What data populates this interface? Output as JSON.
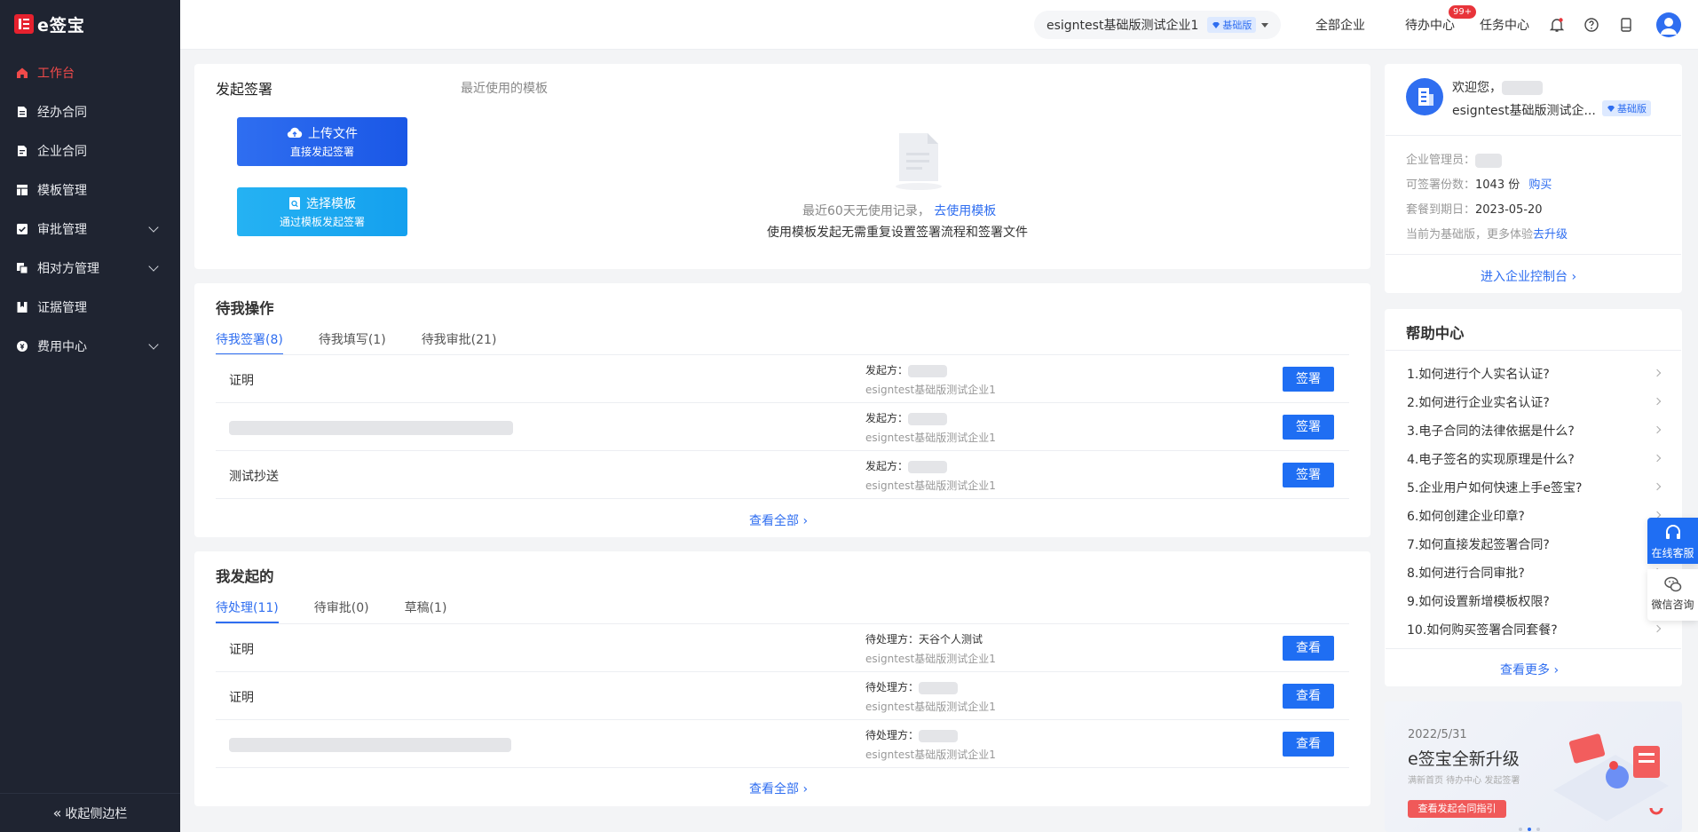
{
  "app": {
    "logo_text": "e签宝"
  },
  "sidebar": {
    "items": [
      {
        "label": "工作台",
        "icon": "home-icon"
      },
      {
        "label": "经办合同",
        "icon": "document-icon"
      },
      {
        "label": "企业合同",
        "icon": "document-icon"
      },
      {
        "label": "模板管理",
        "icon": "template-icon"
      },
      {
        "label": "审批管理",
        "icon": "approval-icon"
      },
      {
        "label": "相对方管理",
        "icon": "contacts-icon"
      },
      {
        "label": "证据管理",
        "icon": "bookmark-icon"
      },
      {
        "label": "费用中心",
        "icon": "coin-icon"
      }
    ],
    "collapse_label": "收起侧边栏"
  },
  "topbar": {
    "org_name": "esigntest基础版测试企业1",
    "plan_badge": "基础版",
    "all_enterprises": "全部企业",
    "todo_center": "待办中心",
    "todo_count": "99+",
    "task_center": "任务中心"
  },
  "initiate": {
    "title": "发起签署",
    "recent_templates_label": "最近使用的模板",
    "upload_btn": {
      "title": "上传文件",
      "subtitle": "直接发起签署"
    },
    "template_btn": {
      "title": "选择模板",
      "subtitle": "通过模板发起签署"
    },
    "empty_text": "最近60天无使用记录，",
    "use_template_link": "去使用模板",
    "empty_hint": "使用模板发起无需重复设置签署流程和签署文件"
  },
  "pending": {
    "title": "待我操作",
    "tabs": [
      "待我签署(8)",
      "待我填写(1)",
      "待我审批(21)"
    ],
    "rows": [
      {
        "name": "证明",
        "meta_label": "发起方：",
        "org": "esigntest基础版测试企业1",
        "action": "签署"
      },
      {
        "name": "",
        "meta_label": "发起方：",
        "org": "esigntest基础版测试企业1",
        "action": "签署"
      },
      {
        "name": "测试抄送",
        "meta_label": "发起方：",
        "org": "esigntest基础版测试企业1",
        "action": "签署"
      }
    ],
    "view_all": "查看全部"
  },
  "initiated": {
    "title": "我发起的",
    "tabs": [
      "待处理(11)",
      "待审批(0)",
      "草稿(1)"
    ],
    "rows": [
      {
        "name": "证明",
        "meta_label": "待处理方：天谷个人测试",
        "org": "esigntest基础版测试企业1",
        "action": "查看"
      },
      {
        "name": "证明",
        "meta_label": "待处理方：",
        "org": "esigntest基础版测试企业1",
        "action": "查看"
      },
      {
        "name": "",
        "meta_label": "待处理方：",
        "org": "esigntest基础版测试企业1",
        "action": "查看"
      }
    ],
    "view_all": "查看全部"
  },
  "account": {
    "welcome": "欢迎您，",
    "org": "esigntest基础版测试企...",
    "plan_badge": "基础版",
    "admin_label": "企业管理员：",
    "quota_label": "可签署份数：",
    "quota_value": "1043 份",
    "buy_link": "购买",
    "expire_label": "套餐到期日：",
    "expire_value": "2023-05-20",
    "upgrade_text": "当前为基础版，更多体验",
    "upgrade_link": "去升级",
    "console_link": "进入企业控制台"
  },
  "help": {
    "title": "帮助中心",
    "items": [
      "1.如何进行个人实名认证?",
      "2.如何进行企业实名认证?",
      "3.电子合同的法律依据是什么?",
      "4.电子签名的实现原理是什么?",
      "5.企业用户如何快速上手e签宝?",
      "6.如何创建企业印章?",
      "7.如何直接发起签署合同?",
      "8.如何进行合同审批?",
      "9.如何设置新增模板权限?",
      "10.如何购买签署合同套餐?"
    ],
    "more": "查看更多"
  },
  "banner": {
    "date": "2022/5/31",
    "title": "e签宝全新升级",
    "subtitle": "满新首页  待办中心  发起签署",
    "button": "查看发起合同指引"
  },
  "floating": {
    "online_service": "在线客服",
    "wechat": "微信咨询"
  },
  "colors": {
    "primary": "#1f6ef3",
    "sidebar": "#1f2431",
    "active": "#f04a4a"
  }
}
